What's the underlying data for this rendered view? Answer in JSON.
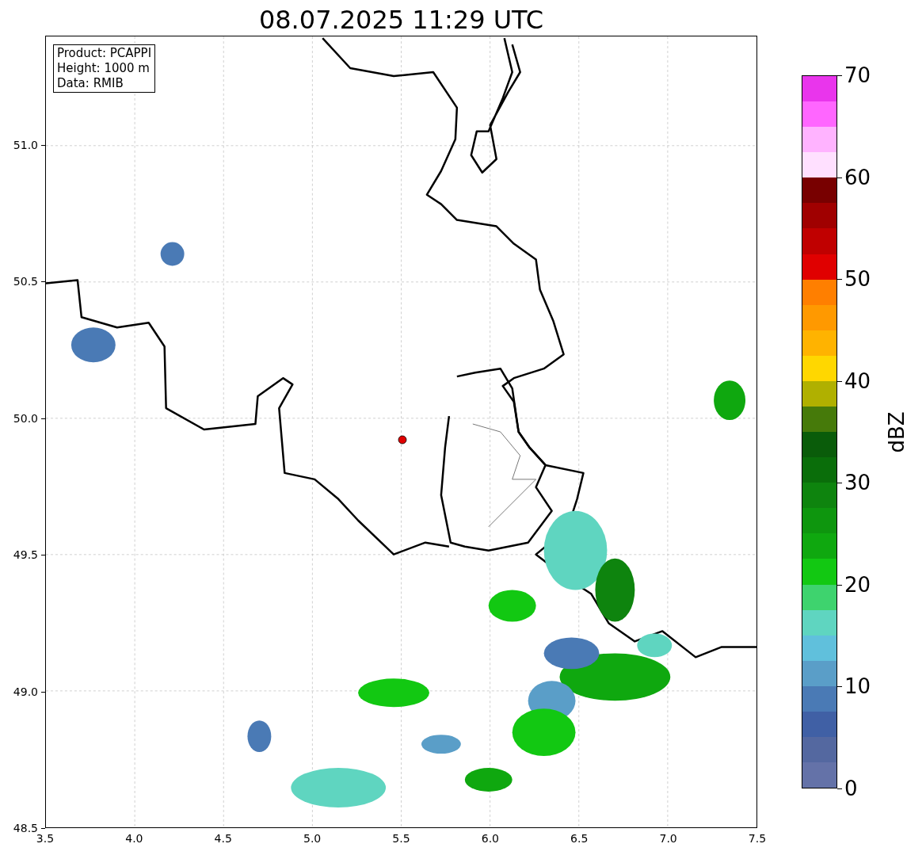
{
  "title": "08.07.2025 11:29 UTC",
  "info_box": [
    "Product: PCAPPI",
    "Height: 1000 m",
    "Data: RMIB"
  ],
  "x_ticks": [
    "3.5",
    "4.0",
    "4.5",
    "5.0",
    "5.5",
    "6.0",
    "6.5",
    "7.0",
    "7.5"
  ],
  "y_ticks": [
    "51.0",
    "50.5",
    "50.0",
    "49.5",
    "49.0",
    "48.5"
  ],
  "colorbar": {
    "label": "dBZ",
    "ticks": [
      "70",
      "60",
      "50",
      "40",
      "30",
      "20",
      "10",
      "0"
    ],
    "segments": [
      {
        "color": "#e935ec"
      },
      {
        "color": "#ff66ff"
      },
      {
        "color": "#ffb3ff"
      },
      {
        "color": "#ffe0ff"
      },
      {
        "color": "#780000"
      },
      {
        "color": "#a00000"
      },
      {
        "color": "#c00000"
      },
      {
        "color": "#e00000"
      },
      {
        "color": "#ff7f00"
      },
      {
        "color": "#ff9900"
      },
      {
        "color": "#ffb300"
      },
      {
        "color": "#ffd700"
      },
      {
        "color": "#b0b000"
      },
      {
        "color": "#467a0a"
      },
      {
        "color": "#0a5c0a"
      },
      {
        "color": "#0a6e0a"
      },
      {
        "color": "#0e840e"
      },
      {
        "color": "#0e960e"
      },
      {
        "color": "#0fa80f"
      },
      {
        "color": "#12c812"
      },
      {
        "color": "#3ed36e"
      },
      {
        "color": "#5fd5c0"
      },
      {
        "color": "#60c0dc"
      },
      {
        "color": "#5a9ec8"
      },
      {
        "color": "#4a7ab5"
      },
      {
        "color": "#4060a5"
      },
      {
        "color": "#5468a0"
      },
      {
        "color": "#6472a8"
      }
    ]
  }
}
